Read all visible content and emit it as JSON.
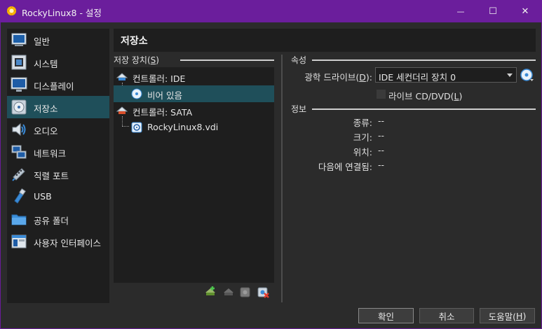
{
  "window": {
    "title": "RockyLinux8 - 설정",
    "controls": {
      "minimize": "—",
      "maximize": "☐",
      "close": "✕"
    }
  },
  "sidebar": {
    "items": [
      {
        "label": "일반",
        "icon": "general-icon"
      },
      {
        "label": "시스템",
        "icon": "system-chip-icon"
      },
      {
        "label": "디스플레이",
        "icon": "display-monitor-icon"
      },
      {
        "label": "저장소",
        "icon": "storage-disk-icon",
        "active": true
      },
      {
        "label": "오디오",
        "icon": "audio-speaker-icon"
      },
      {
        "label": "네트워크",
        "icon": "network-icon"
      },
      {
        "label": "직렬 포트",
        "icon": "serial-port-icon"
      },
      {
        "label": "USB",
        "icon": "usb-icon"
      },
      {
        "label": "공유 폴더",
        "icon": "shared-folder-icon"
      },
      {
        "label": "사용자 인터페이스",
        "icon": "user-interface-icon"
      }
    ]
  },
  "page": {
    "title": "저장소"
  },
  "storage_devices": {
    "label_prefix": "저장 장치(",
    "label_mnemonic": "S",
    "label_suffix": ")",
    "tree": [
      {
        "type": "controller",
        "label": "컨트롤러: IDE",
        "icon": "ide-controller-icon"
      },
      {
        "type": "attachment",
        "label": "비어 있음",
        "icon": "empty-optical-disc-icon",
        "selected": true
      },
      {
        "type": "controller",
        "label": "컨트롤러: SATA",
        "icon": "sata-controller-icon"
      },
      {
        "type": "attachment",
        "label": "RockyLinux8.vdi",
        "icon": "hard-disk-icon"
      }
    ],
    "tools": [
      {
        "name": "add-attachment-icon"
      },
      {
        "name": "remove-attachment-icon"
      },
      {
        "name": "add-controller-icon"
      },
      {
        "name": "remove-controller-icon"
      }
    ]
  },
  "attributes": {
    "section_label": "속성",
    "optical_drive_label_prefix": "광학 드라이브(",
    "optical_drive_mnemonic": "D",
    "optical_drive_label_suffix": "):",
    "optical_drive_value": "IDE 세컨더리 장치 0",
    "live_cd_prefix": "라이브 CD/DVD(",
    "live_cd_mnemonic": "L",
    "live_cd_suffix": ")",
    "live_cd_checked": false
  },
  "info": {
    "section_label": "정보",
    "rows": [
      {
        "label": "종류:",
        "value": "--"
      },
      {
        "label": "크기:",
        "value": "--"
      },
      {
        "label": "위치:",
        "value": "--"
      },
      {
        "label": "다음에 연결됨:",
        "value": "--"
      }
    ]
  },
  "buttons": {
    "ok": "확인",
    "cancel": "취소",
    "help_prefix": "도움말(",
    "help_mnemonic": "H",
    "help_suffix": ")"
  },
  "colors": {
    "titlebar": "#6b1e9c",
    "background": "#2b2b2b",
    "panel": "#1e1e1e",
    "selection": "#1f4f5a",
    "accent_blue": "#2f8fd8"
  }
}
